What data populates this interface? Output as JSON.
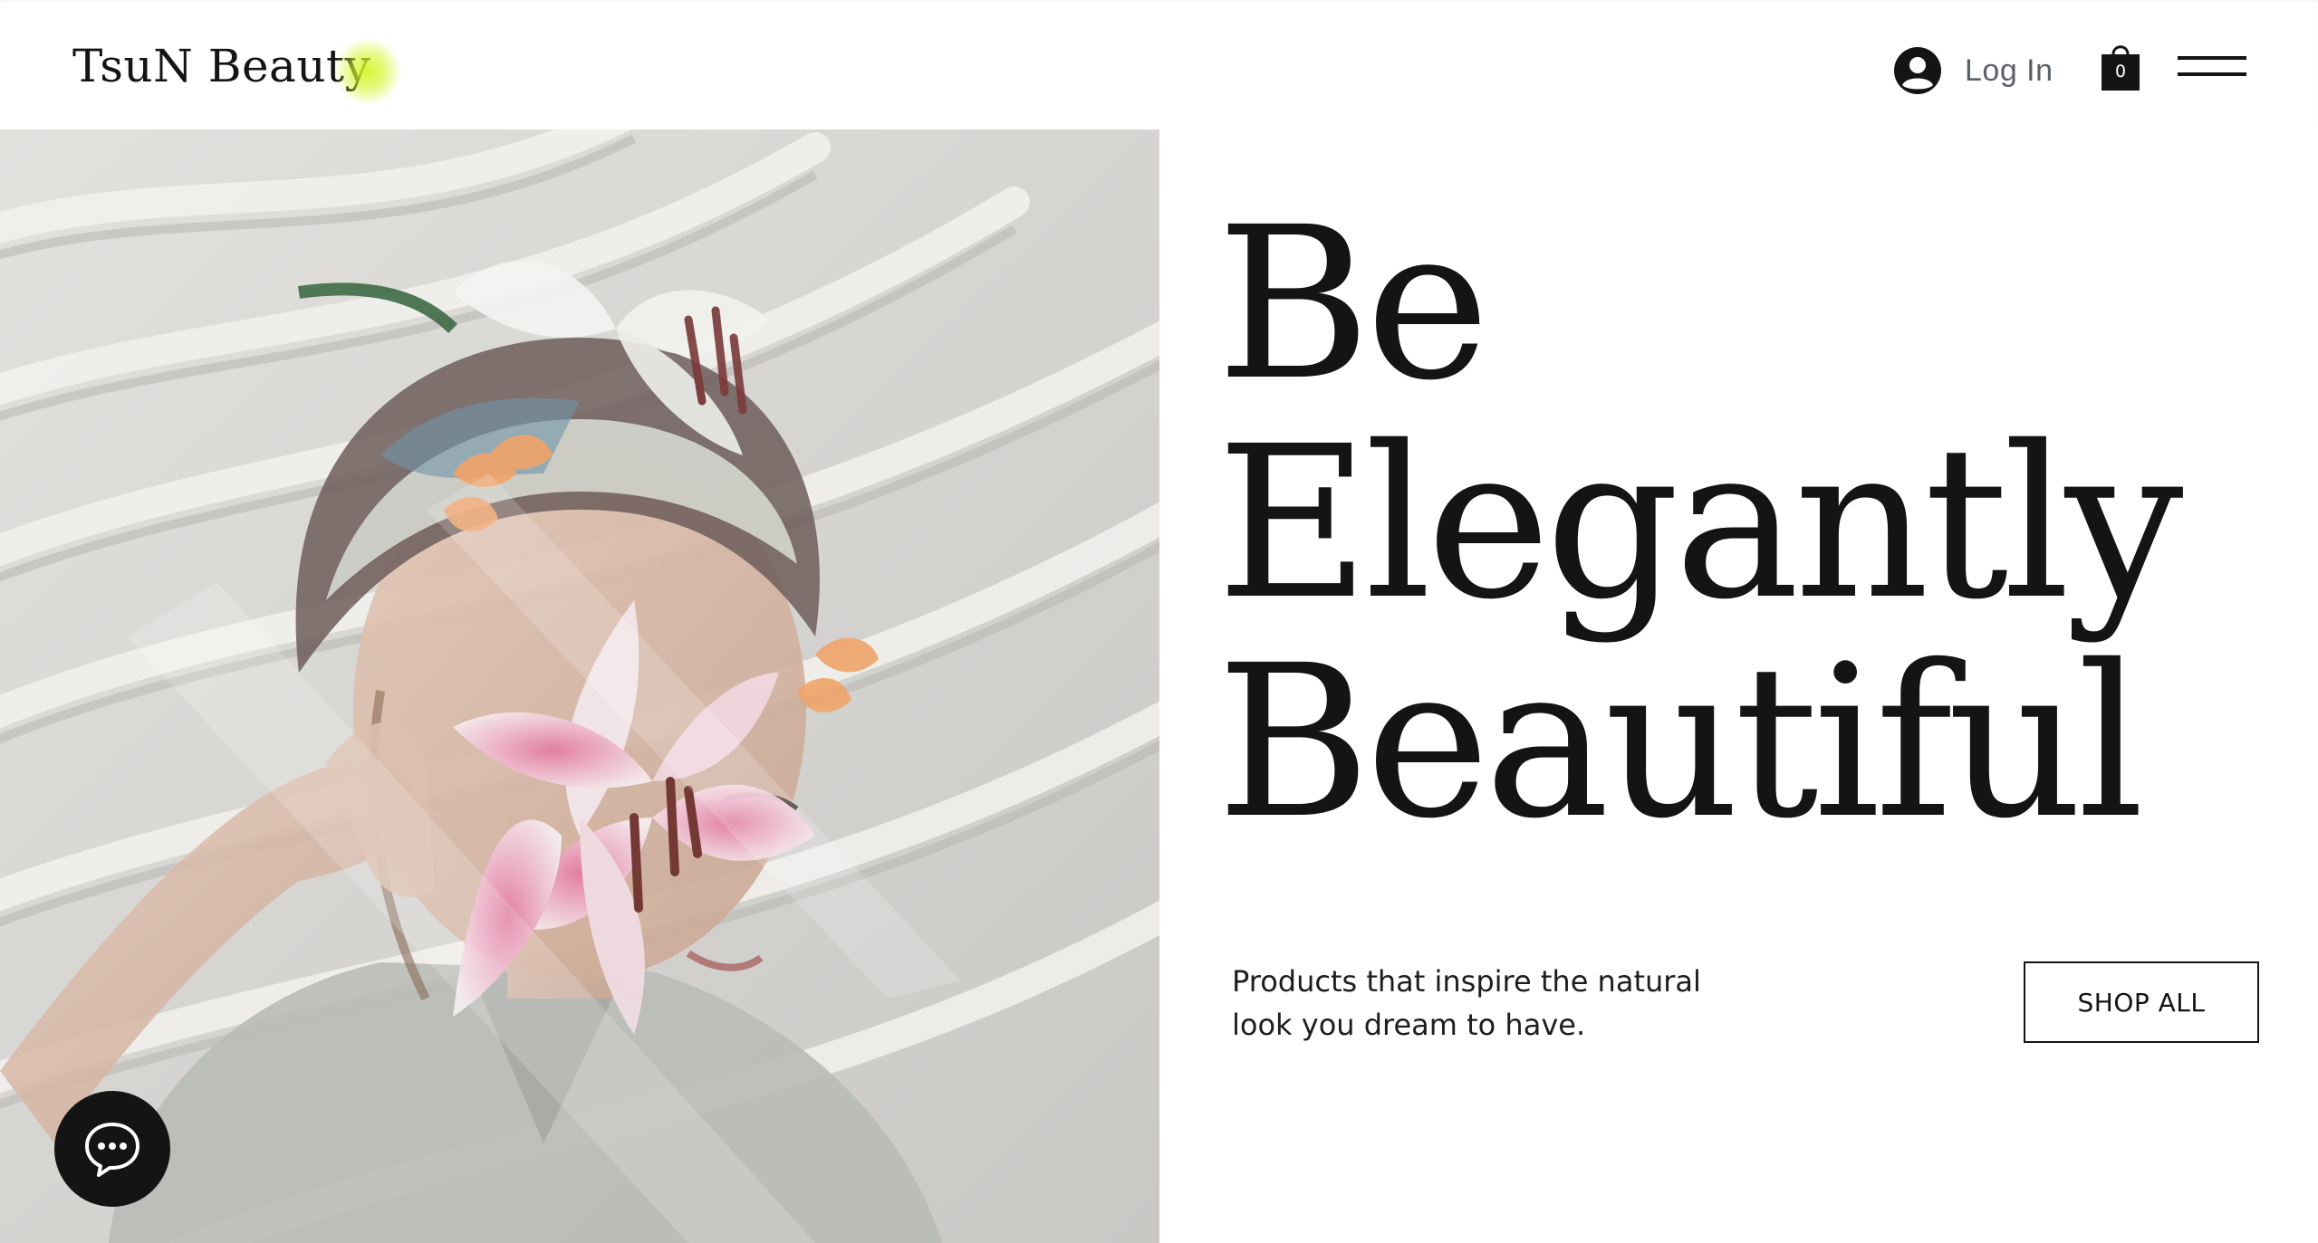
{
  "header": {
    "logo": "TsuN Beauty",
    "login_label": "Log In",
    "cart_count": "0",
    "icons": [
      "user-avatar-icon",
      "shopping-bag-icon",
      "hamburger-menu-icon"
    ]
  },
  "hero": {
    "headline_lines": [
      "Be",
      "Elegantly",
      "Beautiful"
    ],
    "tagline": "Products that inspire the natural look you dream to have.",
    "cta_label": "SHOP ALL"
  },
  "chat": {
    "icon": "chat-bubble-icon"
  },
  "colors": {
    "text": "#141414",
    "muted": "#5b5f66",
    "accent_dot": "#d6f528",
    "background": "#ffffff"
  }
}
